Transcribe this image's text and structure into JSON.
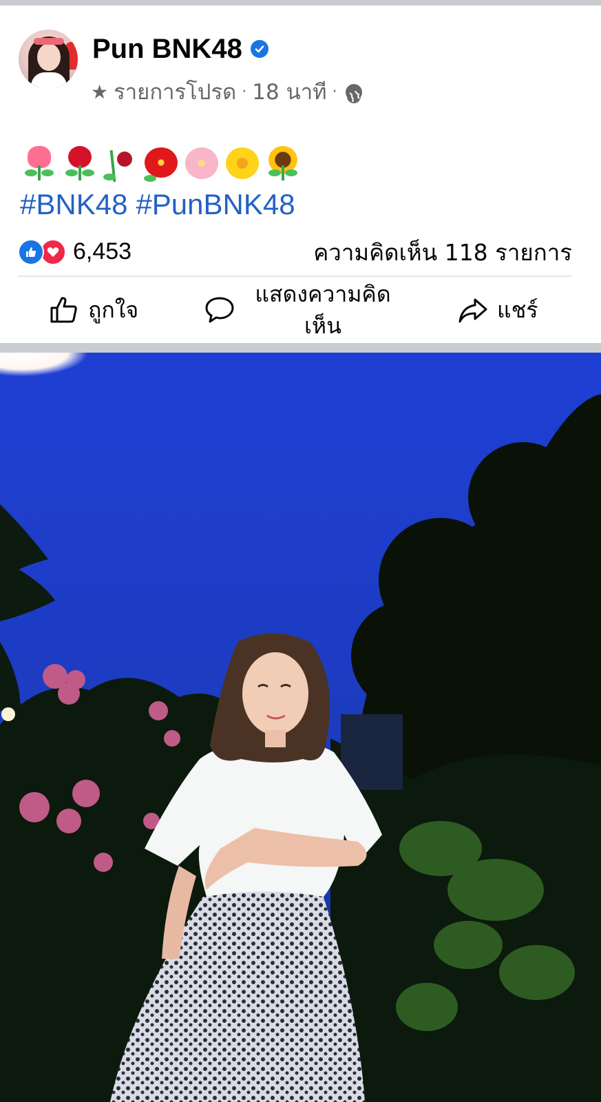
{
  "post": {
    "author": "Pun BNK48",
    "meta": {
      "list_label": "รายการโปรด",
      "time": "18 นาที",
      "separator": "·",
      "star_icon": "star-icon",
      "privacy_icon": "globe-icon"
    },
    "emojis": [
      "tulip",
      "rose",
      "wilted-flower",
      "hibiscus",
      "cherry-blossom",
      "blossom",
      "sunflower"
    ],
    "hashtags": [
      "#BNK48",
      "#PunBNK48"
    ],
    "reactions": {
      "count": "6,453",
      "types": [
        "like",
        "love"
      ]
    },
    "comments_count": "ความคิดเห็น 118 รายการ",
    "actions": {
      "like": "ถูกใจ",
      "comment": "แสดงความคิดเห็น",
      "share": "แชร์"
    }
  },
  "colors": {
    "link": "#2361c4",
    "verified": "#1b74e4",
    "secondary_text": "#65676b",
    "love": "#f02849",
    "separator_bg": "#c9ccd1"
  }
}
